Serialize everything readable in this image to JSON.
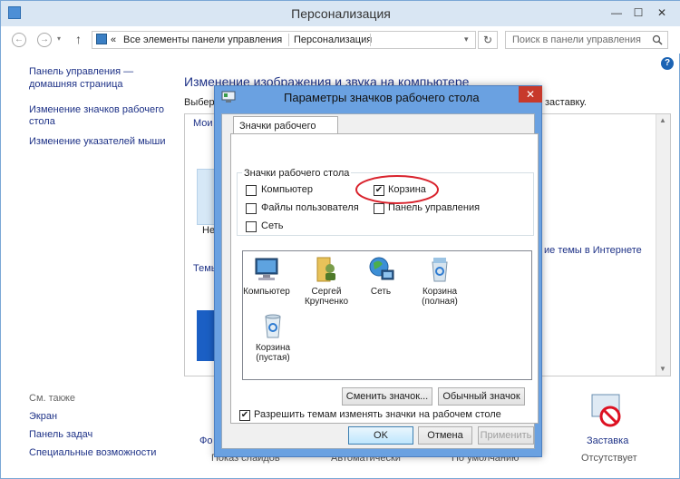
{
  "window": {
    "title": "Персонализация",
    "min": "—",
    "max": "☐",
    "close": "✕"
  },
  "nav": {
    "back": "←",
    "forward": "→",
    "up": "↑",
    "address_parent": "Все элементы панели управления",
    "address_current": "Персонализация",
    "search_placeholder": "Поиск в панели управления",
    "chevrons": "«"
  },
  "sidebar": {
    "items": [
      "Панель управления —",
      "домашняя страница",
      "Изменение значков рабочего",
      "стола",
      "Изменение указателей мыши"
    ],
    "see_also": "См. также",
    "links": [
      "Экран",
      "Панель задач",
      "Специальные возможности"
    ]
  },
  "main": {
    "heading": "Изменение изображения и звука на компьютере",
    "intro_start": "Выбер",
    "intro_end": "заставку.",
    "my_themes": "Мои",
    "ne": "Не",
    "themes_frag": "Темы",
    "online_themes": "ие темы в Интернете",
    "bottom_frag": "Фо",
    "screensaver": "Заставка",
    "screensaver_status": "Отсутствует",
    "bottom_labels": [
      "Показ слайдов",
      "Автоматически",
      "По умолчанию"
    ]
  },
  "dialog": {
    "title": "Параметры значков рабочего стола",
    "close": "✕",
    "tab": "Значки рабочего стола",
    "group_label": "Значки рабочего стола",
    "checkboxes": [
      {
        "label": "Компьютер",
        "checked": false
      },
      {
        "label": "Корзина",
        "checked": true
      },
      {
        "label": "Файлы пользователя",
        "checked": false
      },
      {
        "label": "Панель управления",
        "checked": false
      },
      {
        "label": "Сеть",
        "checked": false
      }
    ],
    "icons": [
      {
        "line1": "Компьютер",
        "line2": "",
        "line3": ""
      },
      {
        "line1": "Сергей",
        "line2": "Крупченко",
        "line3": ""
      },
      {
        "line1": "Сеть",
        "line2": "",
        "line3": ""
      },
      {
        "line1": "Корзина",
        "line2": "(полная)",
        "line3": ""
      },
      {
        "line1": "Корзина",
        "line2": "(пустая)",
        "line3": ""
      }
    ],
    "change_icon": "Сменить значок...",
    "default_icon": "Обычный значок",
    "allow_themes": "Разрешить темам изменять значки на рабочем столе",
    "allow_checked": "✔",
    "ok": "OK",
    "cancel": "Отмена",
    "apply": "Применить"
  },
  "colors": {
    "accent_link": "#1e3287",
    "dialog_frame": "#6aa1e1",
    "highlight_circle": "#d9232d",
    "close_red": "#c7392b"
  }
}
